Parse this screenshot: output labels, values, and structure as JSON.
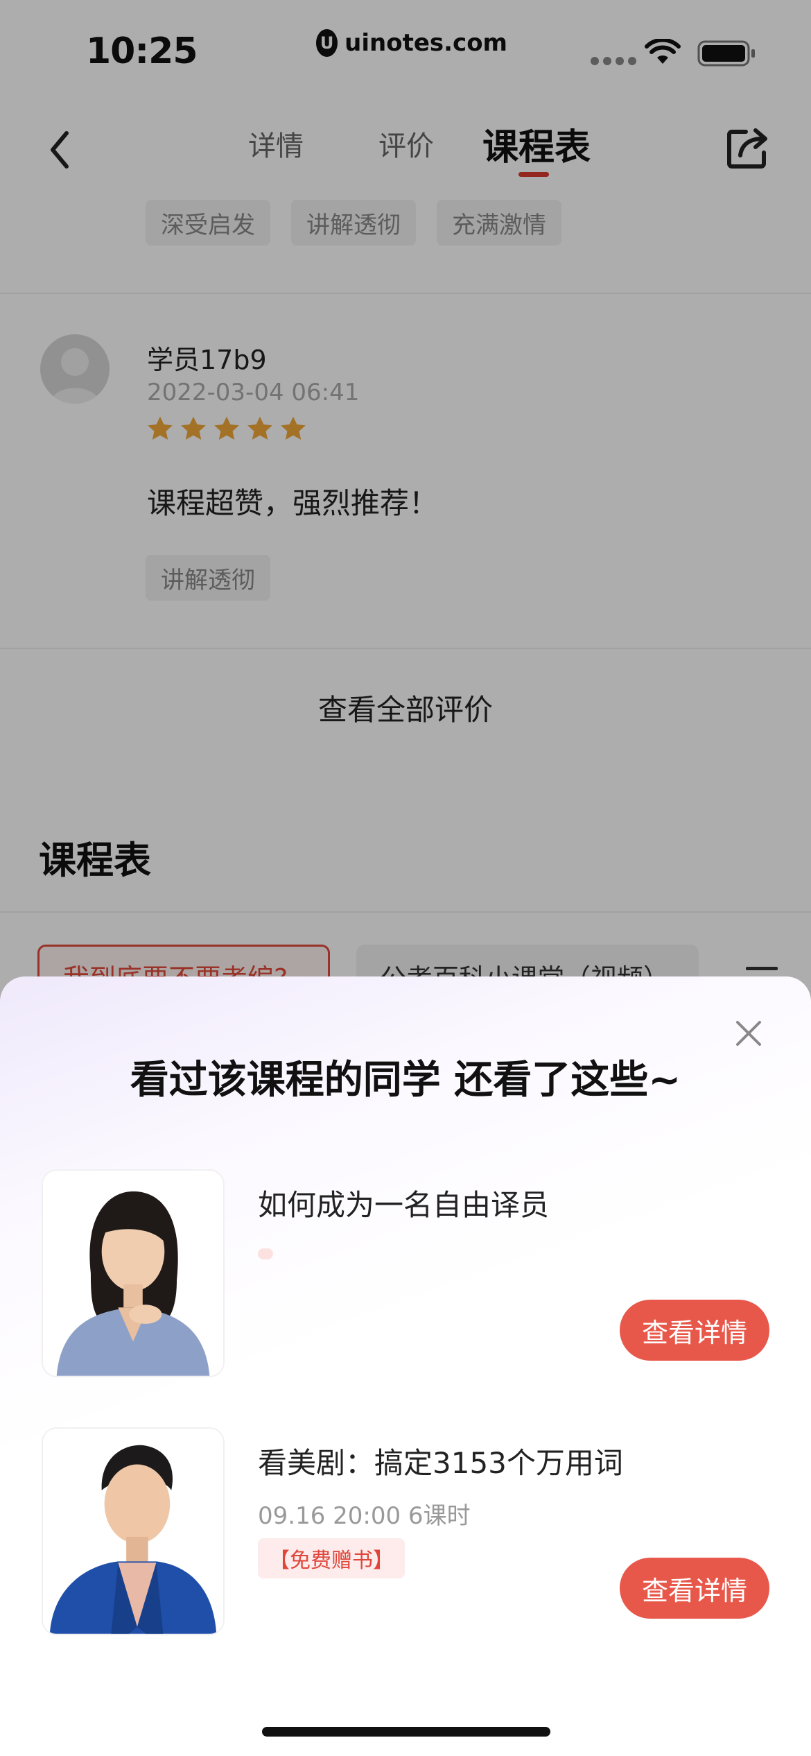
{
  "status_bar": {
    "time": "10:25",
    "url": "uinotes.com",
    "url_logo": "U"
  },
  "nav": {
    "tabs": [
      {
        "label": "详情",
        "active": false
      },
      {
        "label": "评价",
        "active": false
      },
      {
        "label": "课程表",
        "active": true
      }
    ],
    "back_icon": "chevron-left-icon",
    "share_icon": "share-icon"
  },
  "review_tags": [
    "深受启发",
    "讲解透彻",
    "充满激情"
  ],
  "review": {
    "name": "学员17b9",
    "time": "2022-03-04 06:41",
    "stars": 5,
    "text": "课程超赞，强烈推荐！",
    "tag": "讲解透彻"
  },
  "view_all_label": "查看全部评价",
  "schedule": {
    "title": "课程表",
    "chip_active": "我到底要不要考编?",
    "chip_other": "公考百科小课堂（视频）"
  },
  "sheet": {
    "title": "看过该课程的同学 还看了这些~",
    "close_icon": "close-icon",
    "courses": [
      {
        "title": "如何成为一名自由译员",
        "meta": "",
        "tag": "",
        "button": "查看详情"
      },
      {
        "title": "看美剧：搞定3153个万用词",
        "meta": "09.16 20:00 6课时",
        "tag": "【免费赠书】",
        "button": "查看详情"
      }
    ]
  },
  "colors": {
    "accent_red": "#e8584a",
    "star_gold": "#f0a83a",
    "tab_underline": "#d93a2e"
  }
}
